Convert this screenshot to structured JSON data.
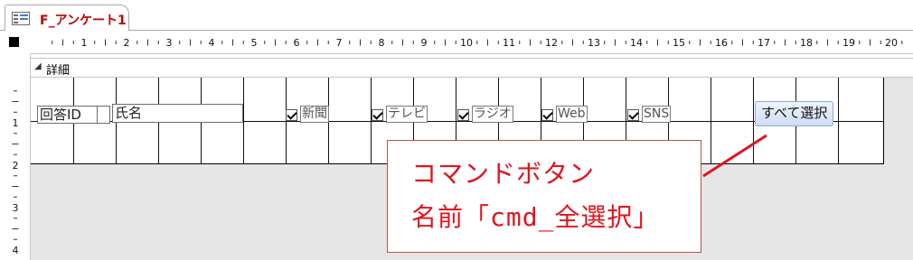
{
  "tab": {
    "label": "F_アンケート1",
    "icon": "form-icon"
  },
  "ruler": {
    "numbers": [
      "1",
      "2",
      "3",
      "4",
      "5",
      "6",
      "7",
      "8",
      "9",
      "10",
      "11",
      "12",
      "13",
      "14",
      "15",
      "16",
      "17",
      "18",
      "19",
      "20"
    ],
    "vertical_numbers": [
      "1",
      "2",
      "3",
      "4"
    ]
  },
  "section": {
    "label": "詳細"
  },
  "controls": {
    "id_label": "回答ID",
    "name_label": "氏名",
    "checkboxes": [
      {
        "label": "新聞",
        "checked": true
      },
      {
        "label": "テレビ",
        "checked": true
      },
      {
        "label": "ラジオ",
        "checked": true
      },
      {
        "label": "Web",
        "checked": true
      },
      {
        "label": "SNS",
        "checked": true
      }
    ],
    "button_label": "すべて選択"
  },
  "callout": {
    "line1": "コマンドボタン",
    "line2": "名前「cmd_全選択」",
    "color": "#e0141e"
  }
}
